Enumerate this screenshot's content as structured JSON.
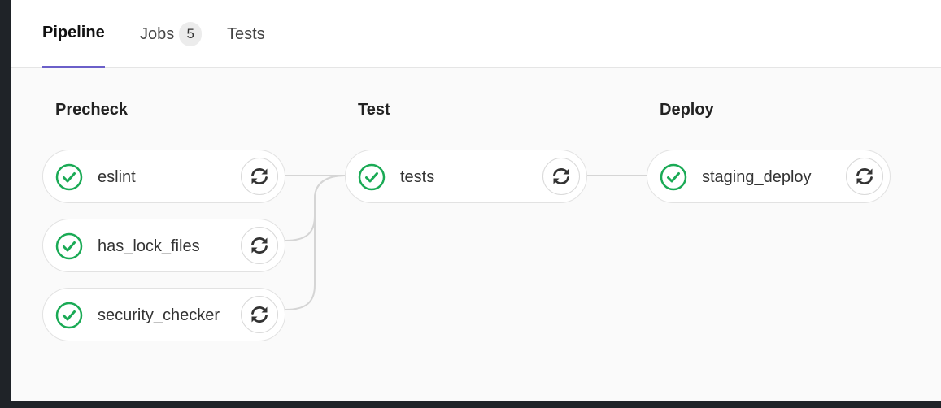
{
  "tabs": [
    {
      "label": "Pipeline",
      "active": true
    },
    {
      "label": "Jobs",
      "badge": "5",
      "active": false
    },
    {
      "label": "Tests",
      "active": false
    }
  ],
  "stages": [
    {
      "title": "Precheck",
      "jobs": [
        {
          "name": "eslint",
          "status": "success"
        },
        {
          "name": "has_lock_files",
          "status": "success"
        },
        {
          "name": "security_checker",
          "status": "success"
        }
      ]
    },
    {
      "title": "Test",
      "jobs": [
        {
          "name": "tests",
          "status": "success"
        }
      ]
    },
    {
      "title": "Deploy",
      "jobs": [
        {
          "name": "staging_deploy",
          "status": "success"
        }
      ]
    }
  ],
  "colors": {
    "success": "#1aaa55",
    "active_tab_underline": "#6b5fc9"
  },
  "icons": {
    "status": "check-circle-icon",
    "action": "retry-icon"
  }
}
